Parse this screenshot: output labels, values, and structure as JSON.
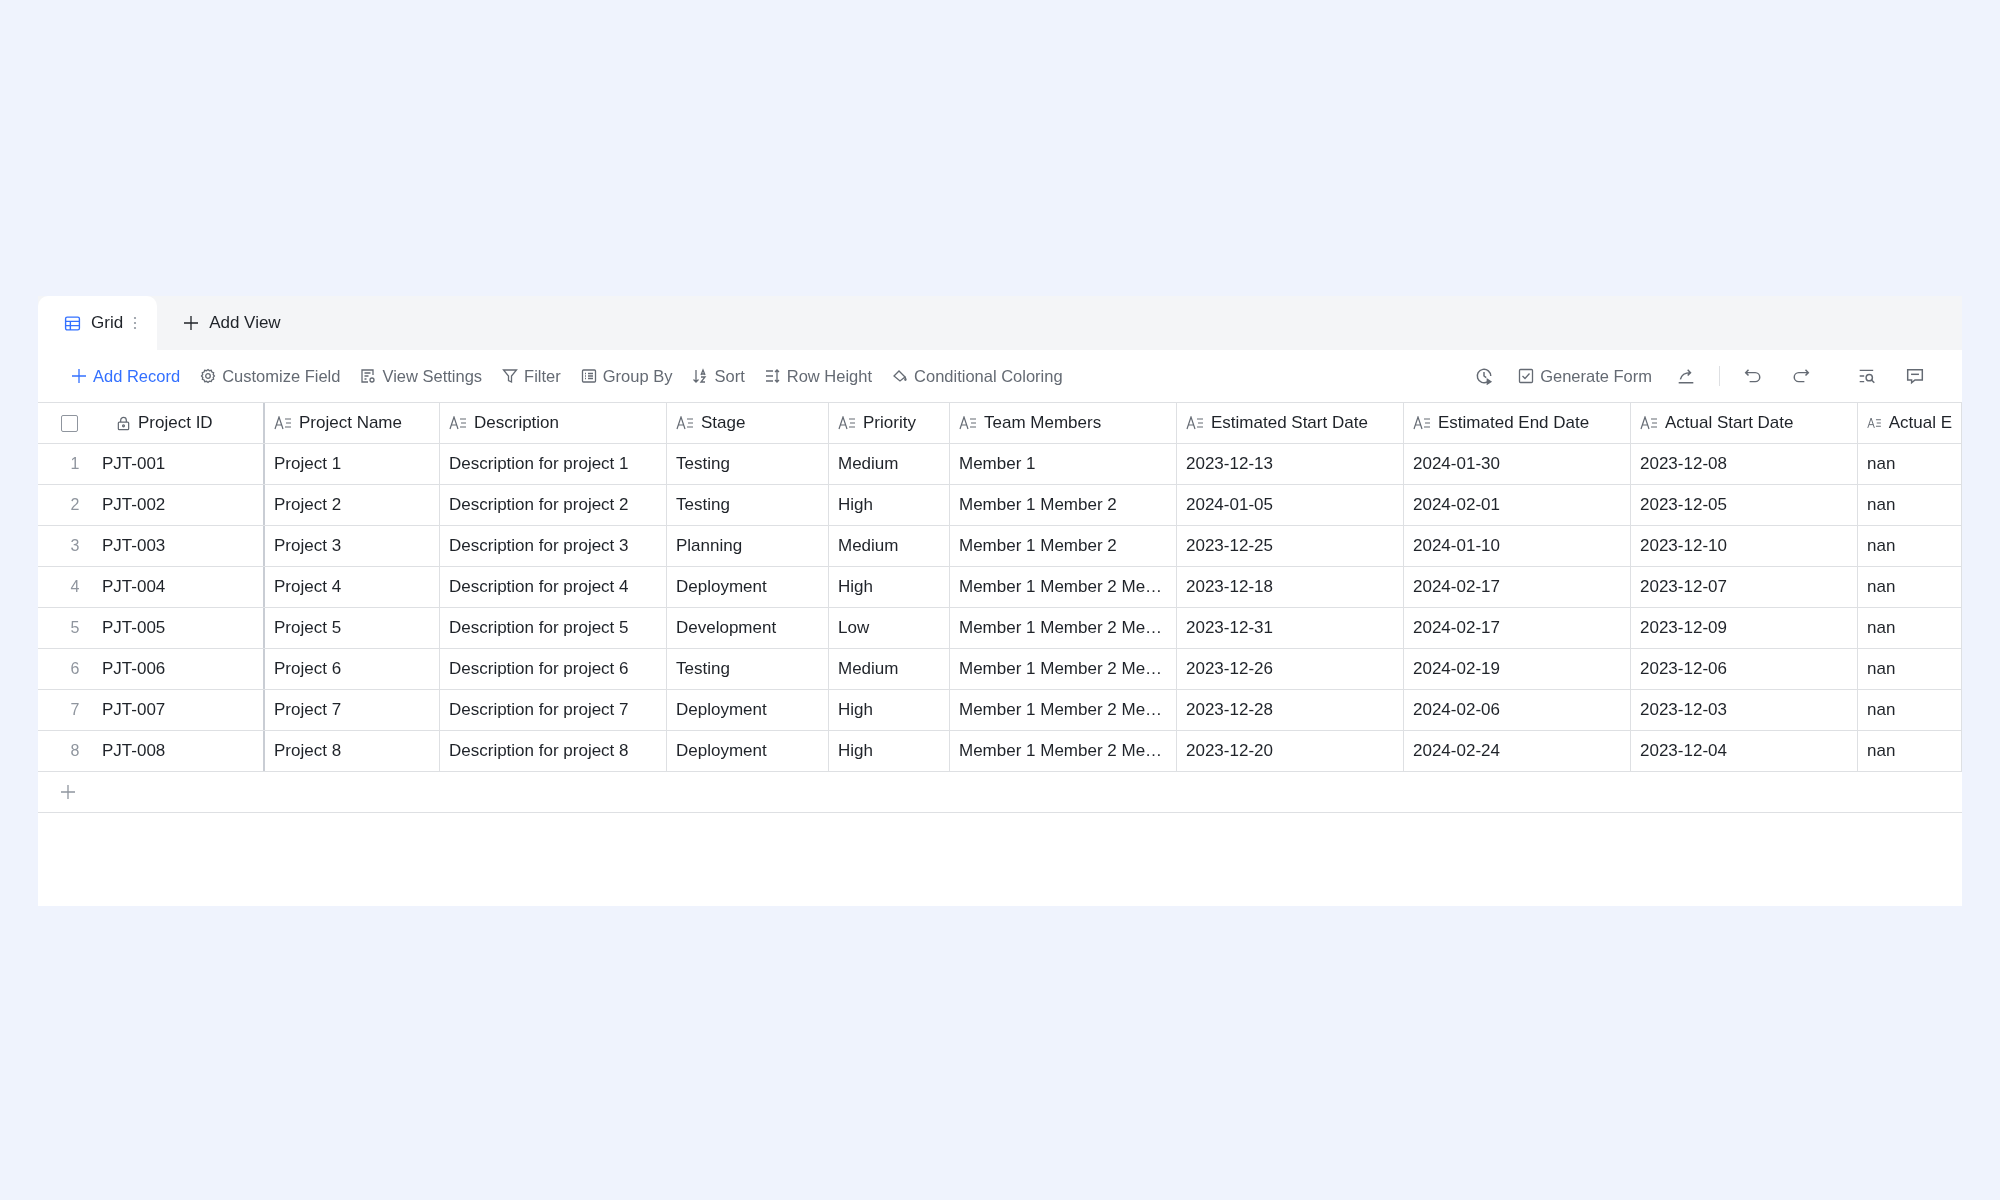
{
  "tabs": [
    {
      "label": "Grid",
      "selected": true
    },
    {
      "label": "Add View",
      "selected": false
    }
  ],
  "toolbar": {
    "left": [
      {
        "label": "Add Record",
        "kind": "primary"
      },
      {
        "label": "Customize Field",
        "kind": "plain"
      },
      {
        "label": "View Settings",
        "kind": "plain"
      },
      {
        "label": "Filter",
        "kind": "plain"
      },
      {
        "label": "Group By",
        "kind": "plain"
      },
      {
        "label": "Sort",
        "kind": "plain"
      },
      {
        "label": "Row Height",
        "kind": "plain"
      },
      {
        "label": "Conditional Coloring",
        "kind": "plain"
      }
    ],
    "generate_form": "Generate Form"
  },
  "table": {
    "select_all": {
      "checked": false
    },
    "columns": [
      {
        "label": "Project ID",
        "kind": "primary"
      },
      {
        "label": "Project Name",
        "kind": "text"
      },
      {
        "label": "Description",
        "kind": "text"
      },
      {
        "label": "Stage",
        "kind": "text"
      },
      {
        "label": "Priority",
        "kind": "text"
      },
      {
        "label": "Team Members",
        "kind": "text"
      },
      {
        "label": "Estimated Start Date",
        "kind": "text"
      },
      {
        "label": "Estimated End Date",
        "kind": "text"
      },
      {
        "label": "Actual Start Date",
        "kind": "text"
      },
      {
        "label": "Actual E",
        "kind": "text"
      }
    ],
    "rows": [
      {
        "index": "1",
        "cells": [
          "PJT-001",
          "Project 1",
          "Description for project 1",
          "Testing",
          "Medium",
          "Member 1",
          "2023-12-13",
          "2024-01-30",
          "2023-12-08",
          "nan"
        ]
      },
      {
        "index": "2",
        "cells": [
          "PJT-002",
          "Project 2",
          "Description for project 2",
          "Testing",
          "High",
          "Member 1 Member 2",
          "2024-01-05",
          "2024-02-01",
          "2023-12-05",
          "nan"
        ]
      },
      {
        "index": "3",
        "cells": [
          "PJT-003",
          "Project 3",
          "Description for project 3",
          "Planning",
          "Medium",
          "Member 1 Member 2",
          "2023-12-25",
          "2024-01-10",
          "2023-12-10",
          "nan"
        ]
      },
      {
        "index": "4",
        "cells": [
          "PJT-004",
          "Project 4",
          "Description for project 4",
          "Deployment",
          "High",
          "Member 1 Member 2 Me…",
          "2023-12-18",
          "2024-02-17",
          "2023-12-07",
          "nan"
        ]
      },
      {
        "index": "5",
        "cells": [
          "PJT-005",
          "Project 5",
          "Description for project 5",
          "Development",
          "Low",
          "Member 1 Member 2 Me…",
          "2023-12-31",
          "2024-02-17",
          "2023-12-09",
          "nan"
        ]
      },
      {
        "index": "6",
        "cells": [
          "PJT-006",
          "Project 6",
          "Description for project 6",
          "Testing",
          "Medium",
          "Member 1 Member 2 Me…",
          "2023-12-26",
          "2024-02-19",
          "2023-12-06",
          "nan"
        ]
      },
      {
        "index": "7",
        "cells": [
          "PJT-007",
          "Project 7",
          "Description for project 7",
          "Deployment",
          "High",
          "Member 1 Member 2 Me…",
          "2023-12-28",
          "2024-02-06",
          "2023-12-03",
          "nan"
        ]
      },
      {
        "index": "8",
        "cells": [
          "PJT-008",
          "Project 8",
          "Description for project 8",
          "Deployment",
          "High",
          "Member 1 Member 2 Me…",
          "2023-12-20",
          "2024-02-24",
          "2023-12-04",
          "nan"
        ]
      }
    ]
  }
}
